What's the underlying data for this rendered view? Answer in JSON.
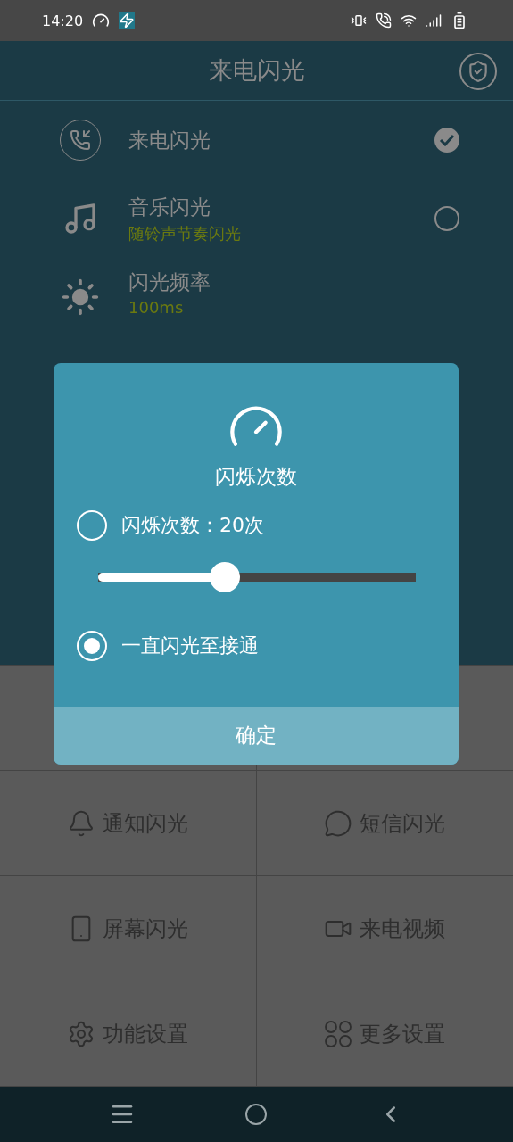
{
  "status_bar": {
    "time": "14:20"
  },
  "header": {
    "title": "来电闪光"
  },
  "settings": [
    {
      "title": "来电闪光",
      "kind": "toggle",
      "checked": true
    },
    {
      "title": "音乐闪光",
      "subtitle": "随铃声节奏闪光",
      "kind": "toggle",
      "checked": false
    },
    {
      "title": "闪光频率",
      "subtitle": "100ms",
      "kind": "plain"
    }
  ],
  "dialog": {
    "title": "闪烁次数",
    "options": [
      {
        "label": "闪烁次数：20次",
        "selected": false
      },
      {
        "label": "一直闪光至接通",
        "selected": true
      }
    ],
    "slider": {
      "level": 0.4
    },
    "button": "确定"
  },
  "grid": [
    {
      "label": "通知闪光"
    },
    {
      "label": "短信闪光"
    },
    {
      "label": "屏幕闪光"
    },
    {
      "label": "来电视频"
    },
    {
      "label": "功能设置"
    },
    {
      "label": "更多设置"
    }
  ]
}
